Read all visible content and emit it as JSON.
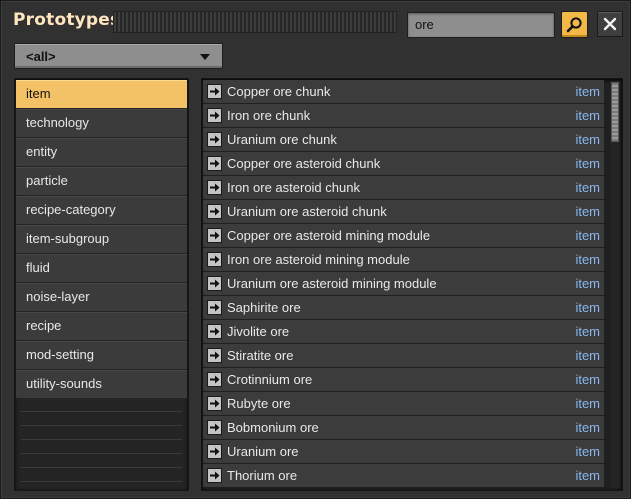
{
  "window": {
    "title": "Prototypes"
  },
  "search": {
    "value": "ore",
    "icon": "magnifier-icon"
  },
  "close": {
    "icon": "close-icon"
  },
  "filter": {
    "selected": "<all>"
  },
  "categories": [
    {
      "label": "item",
      "selected": true
    },
    {
      "label": "technology",
      "selected": false
    },
    {
      "label": "entity",
      "selected": false
    },
    {
      "label": "particle",
      "selected": false
    },
    {
      "label": "recipe-category",
      "selected": false
    },
    {
      "label": "item-subgroup",
      "selected": false
    },
    {
      "label": "fluid",
      "selected": false
    },
    {
      "label": "noise-layer",
      "selected": false
    },
    {
      "label": "recipe",
      "selected": false
    },
    {
      "label": "mod-setting",
      "selected": false
    },
    {
      "label": "utility-sounds",
      "selected": false
    }
  ],
  "results": [
    {
      "name": "Copper ore chunk",
      "type": "item"
    },
    {
      "name": "Iron ore chunk",
      "type": "item"
    },
    {
      "name": "Uranium ore chunk",
      "type": "item"
    },
    {
      "name": "Copper ore asteroid chunk",
      "type": "item"
    },
    {
      "name": "Iron ore asteroid chunk",
      "type": "item"
    },
    {
      "name": "Uranium ore asteroid chunk",
      "type": "item"
    },
    {
      "name": "Copper ore asteroid mining module",
      "type": "item"
    },
    {
      "name": "Iron ore asteroid mining module",
      "type": "item"
    },
    {
      "name": "Uranium ore asteroid mining module",
      "type": "item"
    },
    {
      "name": "Saphirite ore",
      "type": "item"
    },
    {
      "name": "Jivolite ore",
      "type": "item"
    },
    {
      "name": "Stiratite ore",
      "type": "item"
    },
    {
      "name": "Crotinnium ore",
      "type": "item"
    },
    {
      "name": "Rubyte ore",
      "type": "item"
    },
    {
      "name": "Bobmonium ore",
      "type": "item"
    },
    {
      "name": "Uranium ore",
      "type": "item"
    },
    {
      "name": "Thorium ore",
      "type": "item"
    }
  ],
  "colors": {
    "accent": "#f4c266",
    "title": "#ffe6c0",
    "type_link": "#86b6ef"
  }
}
